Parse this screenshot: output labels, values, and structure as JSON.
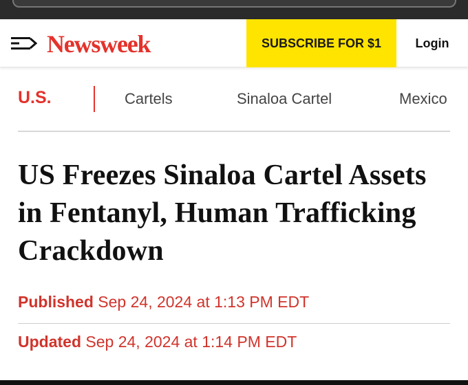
{
  "header": {
    "logo_text": "Newsweek",
    "subscribe_label": "SUBSCRIBE FOR $1",
    "login_label": "Login",
    "menu_icon": "menu-arrow-icon"
  },
  "section_nav": {
    "primary": "U.S.",
    "links": [
      "Cartels",
      "Sinaloa Cartel",
      "Mexico"
    ]
  },
  "article": {
    "headline": "US Freezes Sinaloa Cartel Assets in Fentanyl, Human Trafficking Crackdown",
    "published_label": "Published",
    "published_date": "Sep 24, 2024 at 1:13 PM EDT",
    "updated_label": "Updated",
    "updated_date": "Sep 24, 2024 at 1:14 PM EDT"
  },
  "colors": {
    "brand_red": "#e4322b",
    "subscribe_yellow": "#ffe400"
  }
}
